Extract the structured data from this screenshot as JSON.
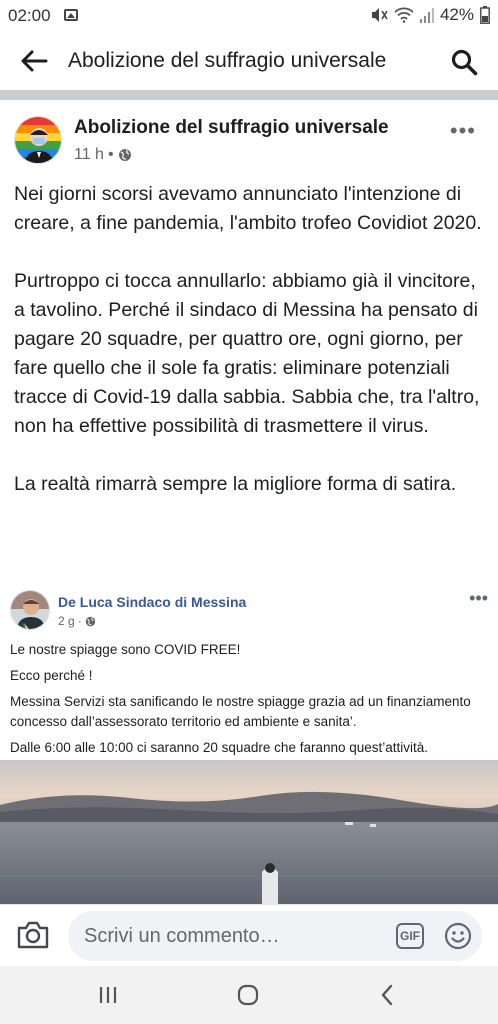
{
  "status_bar": {
    "time": "02:00",
    "battery": "42%"
  },
  "app_bar": {
    "title": "Abolizione del suffragio universale"
  },
  "post": {
    "author": "Abolizione del suffragio universale",
    "time_ago": "11 h",
    "paragraphs": [
      "Nei giorni scorsi avevamo annunciato l'intenzione di creare, a fine pandemia, l'ambito trofeo Covidiot 2020.",
      "Purtroppo ci tocca annullarlo: abbiamo già il vincitore, a tavolino. Perché il sindaco di Messina ha pensato di pagare 20 squadre, per quattro ore, ogni giorno, per fare quello che il sole fa gratis: eliminare potenziali tracce di Covid-19 dalla sabbia. Sabbia che, tra l'altro, non ha effettive possibilità di trasmettere il virus.",
      "La realtà rimarrà sempre la migliore forma di satira."
    ]
  },
  "shared_post": {
    "author": "De Luca Sindaco di Messina",
    "time_ago": "2 g",
    "lines": [
      "Le nostre spiagge sono COVID FREE!",
      "Ecco perché !",
      "Messina Servizi sta sanificando le nostre spiagge grazia ad un finanziamento concesso dall’assessorato territorio ed ambiente e sanita’.",
      "Dalle 6:00 alle 10:00 ci saranno 20 squadre che faranno quest’attività."
    ]
  },
  "comment_bar": {
    "placeholder": "Scrivi un commento…",
    "gif_label": "GIF"
  },
  "icons": {
    "back": "arrow-left-icon",
    "search": "search-icon",
    "more": "more-icon",
    "globe": "globe-icon",
    "camera": "camera-icon",
    "emoji": "emoji-icon",
    "recents": "recents-icon",
    "home": "home-icon",
    "nav_back": "chevron-left-icon"
  }
}
